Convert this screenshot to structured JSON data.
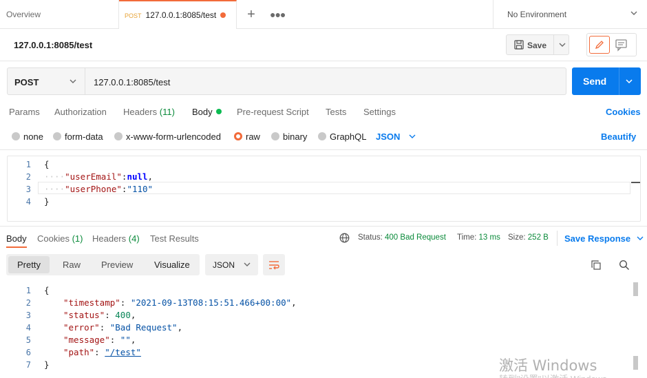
{
  "tabs": {
    "overview": "Overview",
    "active": {
      "method": "POST",
      "title": "127.0.0.1:8085/test"
    },
    "environment": "No Environment"
  },
  "request": {
    "title": "127.0.0.1:8085/test",
    "save_label": "Save",
    "method": "POST",
    "url": "127.0.0.1:8085/test",
    "send_label": "Send"
  },
  "request_tabs": {
    "params": "Params",
    "authorization": "Authorization",
    "headers": "Headers",
    "headers_count": "(11)",
    "body": "Body",
    "prerequest": "Pre-request Script",
    "tests": "Tests",
    "settings": "Settings",
    "cookies": "Cookies"
  },
  "body_types": {
    "none": "none",
    "form_data": "form-data",
    "urlencoded": "x-www-form-urlencoded",
    "raw": "raw",
    "binary": "binary",
    "graphql": "GraphQL",
    "format": "JSON",
    "beautify": "Beautify"
  },
  "request_body": {
    "line_numbers": [
      "1",
      "2",
      "3",
      "4"
    ],
    "open": "{",
    "key1": "\"userEmail\"",
    "val1": "null",
    "key2": "\"userPhone\"",
    "val2": "\"110\"",
    "close": "}"
  },
  "response": {
    "tabs": {
      "body": "Body",
      "cookies": "Cookies",
      "cookies_count": "(1)",
      "headers": "Headers",
      "headers_count": "(4)",
      "test_results": "Test Results"
    },
    "status_label": "Status:",
    "status_value": "400 Bad Request",
    "time_label": "Time:",
    "time_value": "13 ms",
    "size_label": "Size:",
    "size_value": "252 B",
    "save_response": "Save Response",
    "views": {
      "pretty": "Pretty",
      "raw": "Raw",
      "preview": "Preview",
      "visualize": "Visualize"
    },
    "format": "JSON",
    "line_numbers": [
      "1",
      "2",
      "3",
      "4",
      "5",
      "6",
      "7"
    ],
    "open": "{",
    "timestamp_key": "\"timestamp\"",
    "timestamp_val": "\"2021-09-13T08:15:51.466+00:00\"",
    "status_key": "\"status\"",
    "status_val": "400",
    "error_key": "\"error\"",
    "error_val": "\"Bad Request\"",
    "message_key": "\"message\"",
    "message_val": "\"\"",
    "path_key": "\"path\"",
    "path_val": "\"/test\"",
    "close": "}"
  },
  "watermark": {
    "line1": "激活 Windows",
    "line2": "转到\"设置\"以激活 Windows。"
  },
  "colors": {
    "accent": "#f26b3a",
    "send": "#097bed",
    "link": "#097bed",
    "ok_count": "#0a8a3a"
  }
}
